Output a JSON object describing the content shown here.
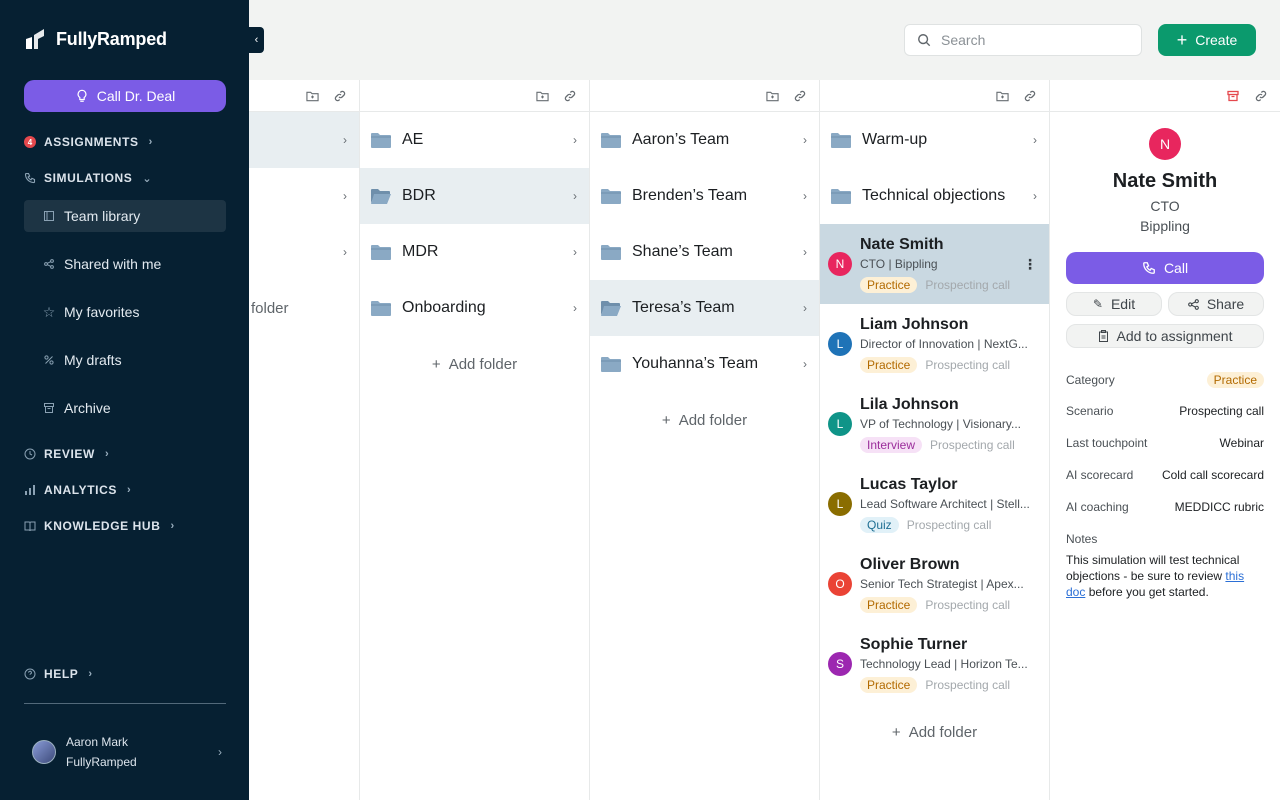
{
  "brand": {
    "name": "FullyRamped"
  },
  "sidebar": {
    "cta_label": "Call Dr. Deal",
    "sections": {
      "assignments": {
        "label": "ASSIGNMENTS",
        "badge": "4"
      },
      "simulations": {
        "label": "SIMULATIONS"
      },
      "review": {
        "label": "REVIEW"
      },
      "analytics": {
        "label": "ANALYTICS"
      },
      "knowledge": {
        "label": "KNOWLEDGE HUB"
      },
      "help": {
        "label": "HELP"
      }
    },
    "sim_items": [
      "Team library",
      "Shared with me",
      "My favorites",
      "My drafts",
      "Archive"
    ],
    "user": {
      "name": "Aaron Mark",
      "org": "FullyRamped"
    }
  },
  "topbar": {
    "search_placeholder": "Search",
    "create_label": "Create"
  },
  "col1": {
    "partial_label": "folder"
  },
  "col2": {
    "items": [
      "AE",
      "BDR",
      "MDR",
      "Onboarding"
    ],
    "add_label": "Add folder"
  },
  "col3": {
    "items": [
      "Aaron’s Team",
      "Brenden’s Team",
      "Shane’s Team",
      "Teresa’s Team",
      "Youhanna’s Team"
    ],
    "add_label": "Add folder"
  },
  "col4": {
    "folders": [
      "Warm-up",
      "Technical objections"
    ],
    "sims": [
      {
        "initial": "N",
        "name": "Nate Smith",
        "sub": "CTO | Bippling",
        "tag": "Practice",
        "scenario": "Prospecting call"
      },
      {
        "initial": "L",
        "name": "Liam Johnson",
        "sub": "Director of Innovation | NextG...",
        "tag": "Practice",
        "scenario": "Prospecting call"
      },
      {
        "initial": "L",
        "name": "Lila Johnson",
        "sub": "VP of Technology | Visionary...",
        "tag": "Interview",
        "scenario": "Prospecting call"
      },
      {
        "initial": "L",
        "name": "Lucas Taylor",
        "sub": "Lead Software Architect | Stell...",
        "tag": "Quiz",
        "scenario": "Prospecting call"
      },
      {
        "initial": "O",
        "name": "Oliver Brown",
        "sub": "Senior Tech Strategist | Apex...",
        "tag": "Practice",
        "scenario": "Prospecting call"
      },
      {
        "initial": "S",
        "name": "Sophie Turner",
        "sub": "Technology Lead | Horizon Te...",
        "tag": "Practice",
        "scenario": "Prospecting call"
      }
    ],
    "add_label": "Add folder"
  },
  "detail": {
    "initial": "N",
    "name": "Nate Smith",
    "title": "CTO",
    "company": "Bippling",
    "call_label": "Call",
    "edit_label": "Edit",
    "share_label": "Share",
    "assign_label": "Add to assignment",
    "meta": {
      "category_label": "Category",
      "category": "Practice",
      "scenario_label": "Scenario",
      "scenario": "Prospecting call",
      "touch_label": "Last touchpoint",
      "touch": "Webinar",
      "scorecard_label": "AI scorecard",
      "scorecard": "Cold call scorecard",
      "coaching_label": "AI coaching",
      "coaching": "MEDDICC rubric"
    },
    "notes_label": "Notes",
    "notes_text": "This simulation will test technical objections - be sure to review",
    "notes_link": "this doc",
    "notes_tail": "before you get started."
  },
  "colors": {
    "sidebar_bg": "#062032",
    "accent_purple": "#7b5ce6",
    "create_green": "#0b9a6d",
    "folder_blue": "#8aa9c4"
  }
}
